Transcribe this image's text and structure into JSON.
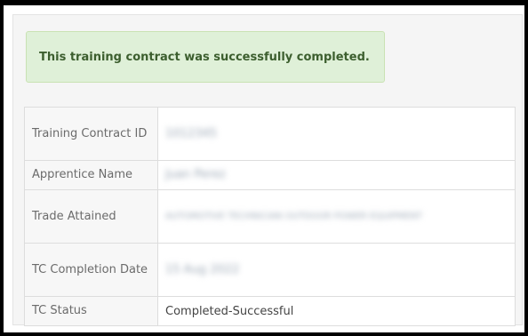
{
  "alert": {
    "message": "This training contract was successfully completed."
  },
  "details": {
    "rows": [
      {
        "label": "Training Contract ID",
        "value": "1012345"
      },
      {
        "label": "Apprentice Name",
        "value": "Juan Perez"
      },
      {
        "label": "Trade Attained",
        "value": "AUTOMOTIVE TECHNICIAN OUTDOOR POWER EQUIPMENT"
      },
      {
        "label": "TC Completion Date",
        "value": "15 Aug 2022"
      },
      {
        "label": "TC Status",
        "value": "Completed-Successful"
      }
    ]
  }
}
